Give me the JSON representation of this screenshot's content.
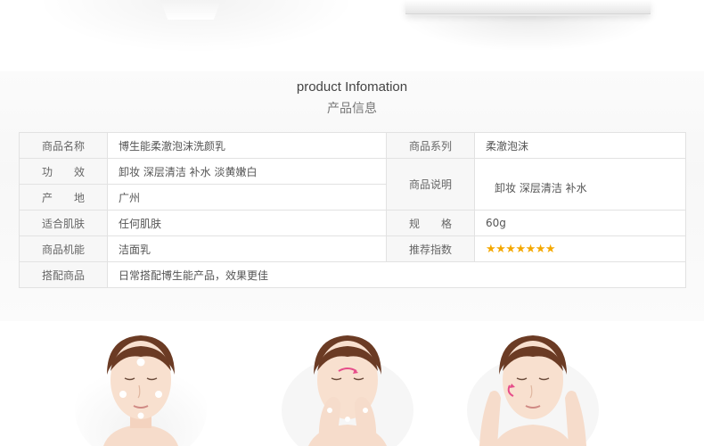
{
  "heading": {
    "en": "product Infomation",
    "cn": "产品信息"
  },
  "table": {
    "rows": [
      {
        "l1": "商品名称",
        "v1": "博生能柔澈泡沫洗颜乳",
        "l2": "商品系列",
        "v2": "柔澈泡沫"
      },
      {
        "l1": "功　　效",
        "v1": "卸妆 深层清洁  补水  淡黄嫩白"
      },
      {
        "l1": "产　　地",
        "v1": "广州"
      },
      {
        "l1": "适合肌肤",
        "v1": "任何肌肤",
        "l2": "规　　格",
        "v2": "60g"
      },
      {
        "l1": "商品机能",
        "v1": "洁面乳",
        "l2": "推荐指数",
        "stars": "★★★★★★★"
      },
      {
        "l1": "搭配商品",
        "v1": "日常搭配博生能产品，效果更佳"
      }
    ],
    "merged": {
      "label": "商品说明",
      "value": "卸妆 深层清洁  补水"
    }
  },
  "illustrations": [
    "face-foam-dots-icon",
    "face-washing-nose-icon",
    "face-massage-cheeks-icon"
  ],
  "colors": {
    "star": "#f5a800",
    "label_bg": "#f7f7f7",
    "border": "#e2e2e2",
    "arrow": "#e64d8a"
  }
}
